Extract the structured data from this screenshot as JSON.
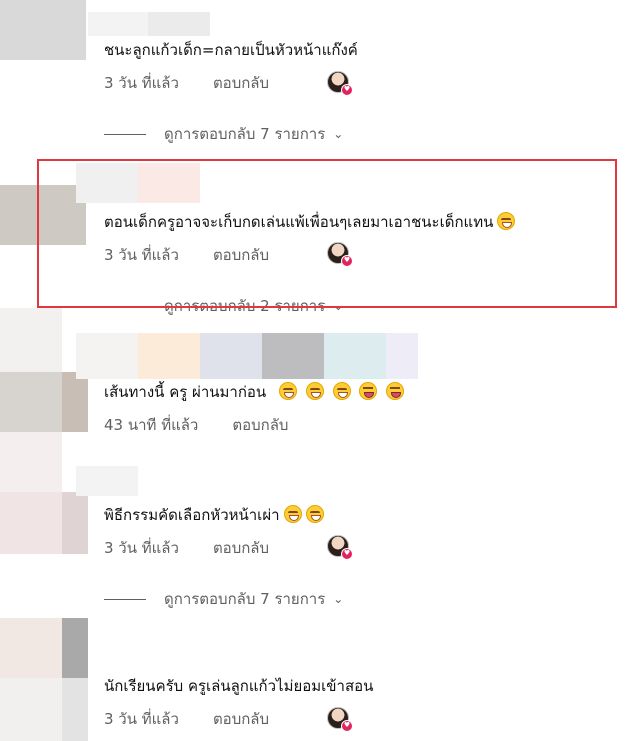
{
  "colors": {
    "highlight": "#e0383e",
    "meta_text": "#606060",
    "heart_badge": "#e0245e"
  },
  "comments": [
    {
      "text": "ชนะลูกแก้วเด็ก=กลายเป็นหัวหน้าแก๊งค์",
      "time": "3 วัน ที่แล้ว",
      "reply": "ตอบกลับ",
      "replies": "ดูการตอบกลับ 7 รายการ"
    },
    {
      "text": "ตอนเด็กครูอาจจะเก็บกดเล่นแพ้เพื่อนๆเลยมาเอาชนะเด็กแทน",
      "emojis": [
        "rolling-laughing-emoji"
      ],
      "time": "3 วัน ที่แล้ว",
      "reply": "ตอบกลับ",
      "replies": "ดูการตอบกลับ 2 รายการ"
    },
    {
      "text": "เส้นทางนี้ ครู ผ่านมาก่อน",
      "emojis": [
        "grinning-emoji",
        "grinning-emoji",
        "grinning-emoji",
        "squinting-tongue-emoji",
        "squinting-tongue-emoji"
      ],
      "time": "43 นาที ที่แล้ว",
      "reply": "ตอบกลับ"
    },
    {
      "text": "พิธีกรรมคัดเลือกหัวหน้าเผ่า",
      "emojis": [
        "rolling-laughing-emoji",
        "rolling-laughing-emoji"
      ],
      "time": "3 วัน ที่แล้ว",
      "reply": "ตอบกลับ",
      "replies": "ดูการตอบกลับ 7 รายการ"
    },
    {
      "text": "นักเรียนครับ ครูเล่นลูกแก้วไม่ยอมเข้าสอน",
      "time": "3 วัน ที่แล้ว",
      "reply": "ตอบกลับ"
    }
  ]
}
